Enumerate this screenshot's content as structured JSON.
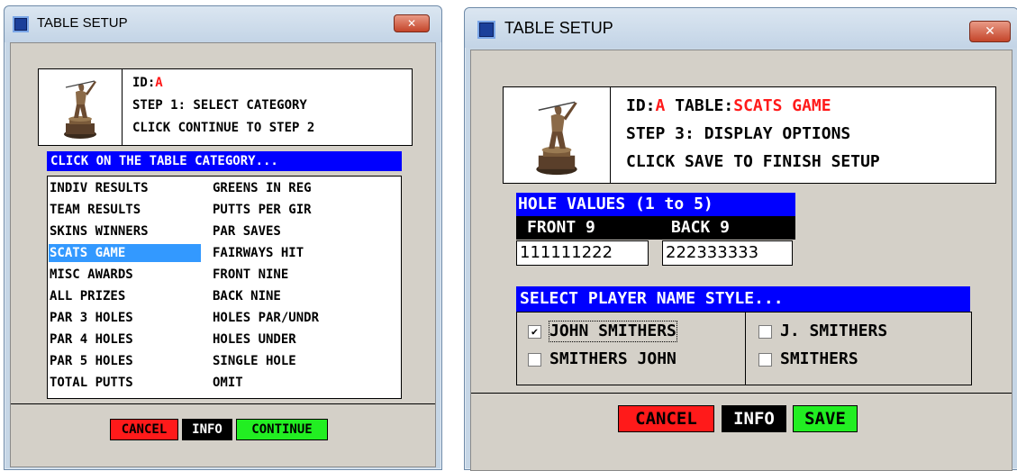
{
  "left_window": {
    "title": "TABLE SETUP",
    "close_glyph": "✕",
    "header": {
      "id_label": "ID:",
      "id_value": "A",
      "step_line": "STEP 1: SELECT CATEGORY",
      "hint_line": "CLICK CONTINUE TO STEP 2"
    },
    "category_prompt": "CLICK ON THE TABLE CATEGORY...",
    "categories_left": [
      "INDIV RESULTS",
      "TEAM RESULTS",
      "SKINS WINNERS",
      "SCATS GAME",
      "MISC AWARDS",
      "ALL PRIZES",
      "PAR 3 HOLES",
      "PAR 4 HOLES",
      "PAR 5 HOLES",
      "TOTAL PUTTS"
    ],
    "categories_right": [
      "GREENS IN REG",
      "PUTTS PER GIR",
      "PAR SAVES",
      "FAIRWAYS HIT",
      "FRONT NINE",
      "BACK NINE",
      "HOLES PAR/UNDR",
      "HOLES UNDER",
      "SINGLE HOLE",
      "OMIT"
    ],
    "selected_category": "SCATS GAME",
    "buttons": {
      "cancel": "CANCEL",
      "info": "INFO",
      "continue": "CONTINUE"
    }
  },
  "right_window": {
    "title": "TABLE SETUP",
    "close_glyph": "✕",
    "header": {
      "id_label": "ID:",
      "id_value": "A",
      "table_label": "TABLE:",
      "table_value": "SCATS GAME",
      "step_line": "STEP 3: DISPLAY OPTIONS",
      "hint_line": "CLICK SAVE TO FINISH SETUP"
    },
    "hole_values": {
      "heading": "HOLE VALUES (1 to 5)",
      "front_label": "FRONT 9",
      "back_label": "BACK 9",
      "front_value": "111111222",
      "back_value": "222333333"
    },
    "name_style": {
      "heading": "SELECT PLAYER NAME STYLE...",
      "options": [
        {
          "label": "JOHN SMITHERS",
          "checked": true
        },
        {
          "label": "J. SMITHERS",
          "checked": false
        },
        {
          "label": "SMITHERS JOHN",
          "checked": false
        },
        {
          "label": "SMITHERS",
          "checked": false
        }
      ],
      "check_glyph": "✔"
    },
    "buttons": {
      "cancel": "CANCEL",
      "info": "INFO",
      "save": "SAVE"
    }
  },
  "colors": {
    "accent_blue": "#0000ff",
    "selection": "#3399ff",
    "cancel_red": "#ff1a1a",
    "go_green": "#22ee22",
    "id_red": "#ff1a1a"
  }
}
